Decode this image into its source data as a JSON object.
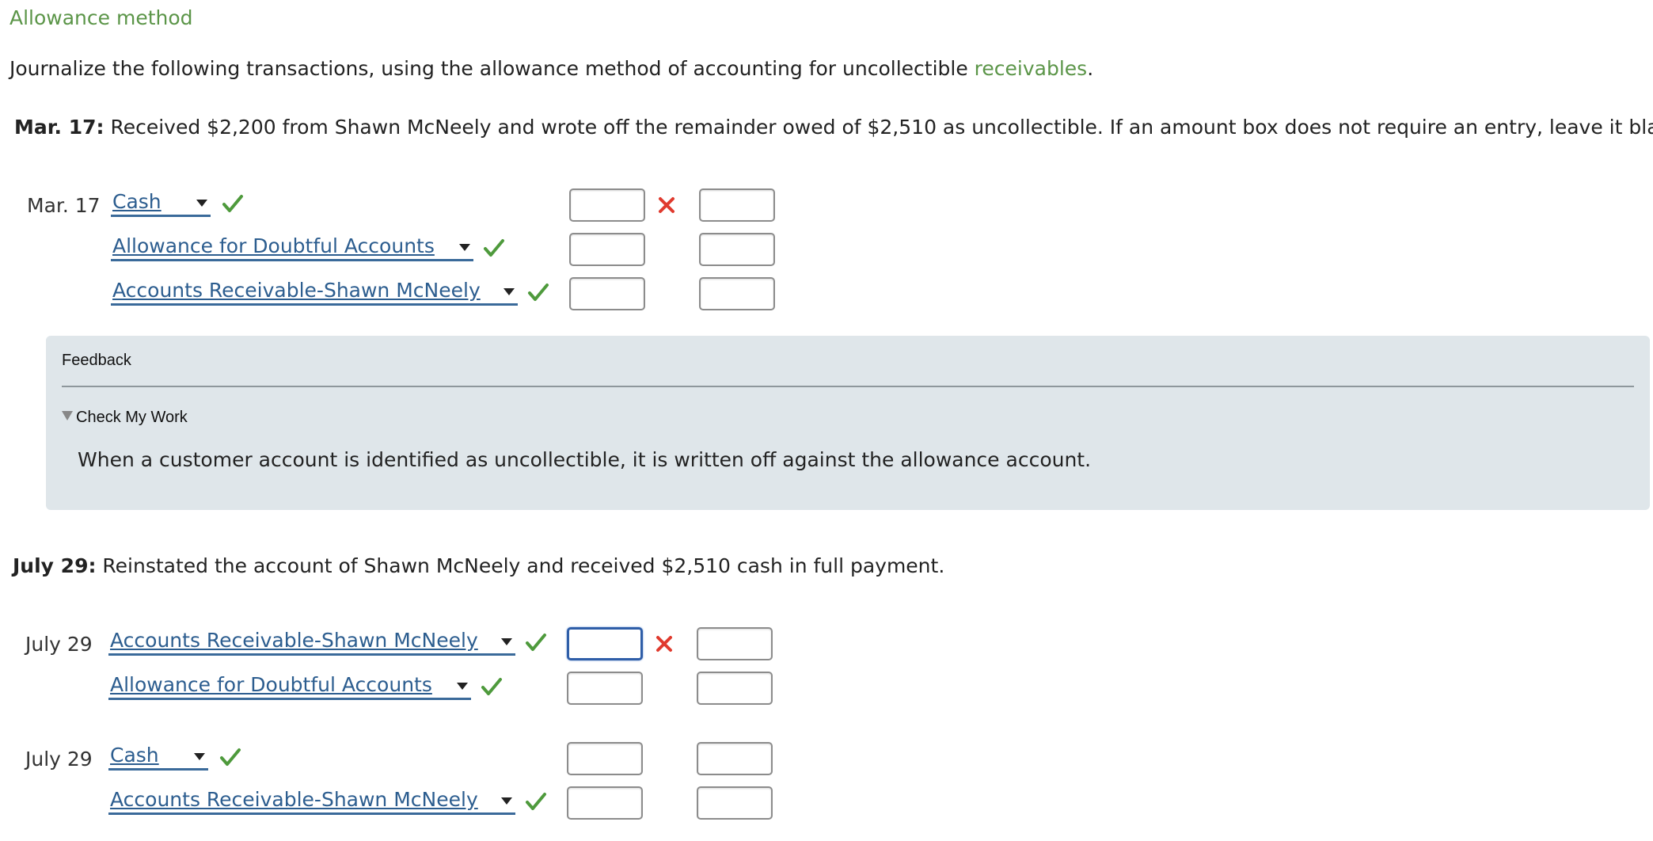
{
  "section_title": "Allowance method",
  "instructions": {
    "text_before": "Journalize the following transactions, using the allowance method of accounting for uncollectible ",
    "link_text": "receivables",
    "text_after": "."
  },
  "transactions": [
    {
      "label": "Mar. 17:",
      "text": "Received $2,200 from Shawn McNeely and wrote off the remainder owed of $2,510 as uncollectible. If an amount box does not require an entry, leave it blank.",
      "entries": [
        {
          "date": "Mar. 17",
          "account": "Cash",
          "status": "correct",
          "debit": "",
          "credit": "",
          "amount_status": "incorrect"
        },
        {
          "date": "",
          "account": "Allowance for Doubtful Accounts",
          "status": "correct",
          "debit": "",
          "credit": ""
        },
        {
          "date": "",
          "account": "Accounts Receivable-Shawn McNeely",
          "status": "correct",
          "debit": "",
          "credit": ""
        }
      ]
    },
    {
      "label": "July 29:",
      "text": "Reinstated the account of Shawn McNeely and received $2,510 cash in full payment.",
      "entries": [
        {
          "date": "July 29",
          "account": "Accounts Receivable-Shawn McNeely",
          "status": "correct",
          "debit": "",
          "credit": "",
          "amount_status": "incorrect",
          "focused": true
        },
        {
          "date": "",
          "account": "Allowance for Doubtful Accounts",
          "status": "correct",
          "debit": "",
          "credit": ""
        },
        {
          "date": "July 29",
          "account": "Cash",
          "status": "correct",
          "debit": "",
          "credit": ""
        },
        {
          "date": "",
          "account": "Accounts Receivable-Shawn McNeely",
          "status": "correct",
          "debit": "",
          "credit": ""
        }
      ]
    }
  ],
  "feedback": {
    "title": "Feedback",
    "toggle_label": "Check My Work",
    "message": "When a customer account is identified as uncollectible, it is written off against the allowance account."
  },
  "colors": {
    "accent_green": "#5b9548",
    "link_blue": "#2c5d8f",
    "check_green": "#4e9a3c",
    "error_red": "#e03a2e",
    "feedback_bg": "#dfe6ea"
  }
}
